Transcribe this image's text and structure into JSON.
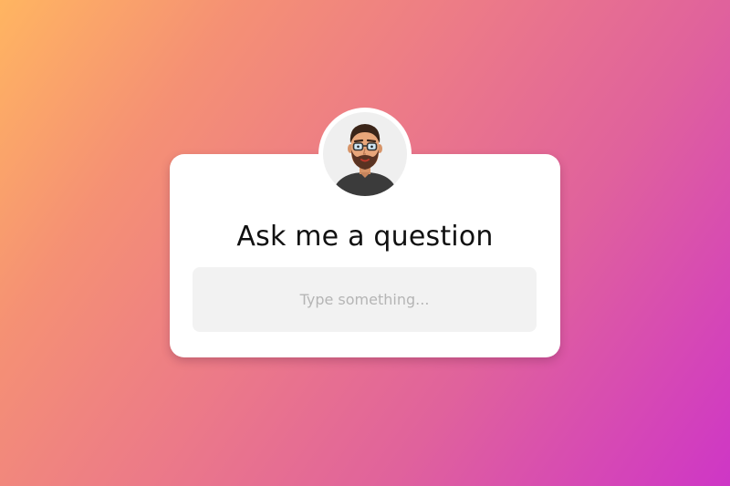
{
  "widget": {
    "title": "Ask me a question",
    "input_placeholder": "Type something...",
    "input_value": "",
    "avatar_icon": "bearded-man-with-glasses-avatar"
  },
  "colors": {
    "gradient_start": "#ffb561",
    "gradient_end": "#ce36c6",
    "card": "#ffffff",
    "input_bg": "#f2f2f2",
    "placeholder": "#b5b5b5",
    "title_text": "#111111"
  }
}
